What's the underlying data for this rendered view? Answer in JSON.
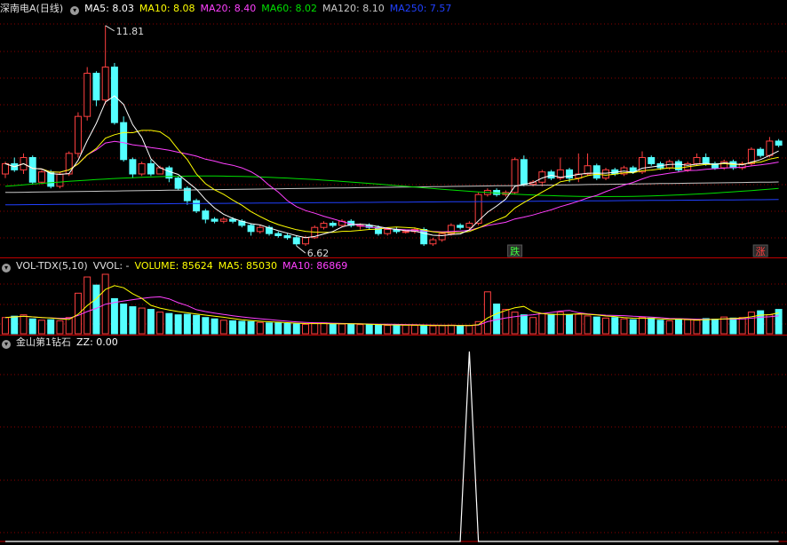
{
  "colors": {
    "up": "#ff4040",
    "down": "#54ffff",
    "ma5": "#ffffff",
    "ma10": "#ffff00",
    "ma20": "#ff40ff",
    "ma60": "#00e000",
    "ma120": "#c8c8c8",
    "ma250": "#2040ff",
    "grid": "#8c0000",
    "border": "#c00000",
    "zz": "#ffffff"
  },
  "main": {
    "title": "深南电A(日线)",
    "icon": "chevron-down-icon",
    "ma": [
      {
        "label": "MA5: 8.03",
        "color": "#ffffff"
      },
      {
        "label": "MA10: 8.08",
        "color": "#ffff00"
      },
      {
        "label": "MA20: 8.40",
        "color": "#ff40ff"
      },
      {
        "label": "MA60: 8.02",
        "color": "#00e000"
      },
      {
        "label": "MA120: 8.10",
        "color": "#c8c8c8"
      },
      {
        "label": "MA250: 7.57",
        "color": "#2040ff"
      }
    ],
    "high_label": "11.81",
    "low_label": "6.62",
    "mark_fall": "跌",
    "mark_rise": "涨"
  },
  "vol": {
    "name": "VOL-TDX(5,10)",
    "vvol": "VVOL: -",
    "volume": "VOLUME: 85624",
    "ma5": "MA5: 85030",
    "ma10": "MA10: 86869",
    "icon": "chevron-down-icon"
  },
  "ind": {
    "name": "金山第1钻石",
    "zz": "ZZ: 0.00",
    "icon": "chevron-down-icon"
  },
  "chart_data": [
    {
      "type": "candlestick",
      "series": [
        {
          "name": "K",
          "ohlc": [
            [
              8.2,
              8.45,
              8.5,
              8.1
            ],
            [
              8.45,
              8.3,
              8.6,
              8.25
            ],
            [
              8.3,
              8.6,
              8.7,
              8.2
            ],
            [
              8.6,
              8.0,
              8.65,
              7.95
            ],
            [
              8.0,
              8.25,
              8.3,
              7.95
            ],
            [
              8.25,
              7.9,
              8.3,
              7.85
            ],
            [
              7.9,
              8.2,
              8.25,
              7.85
            ],
            [
              8.2,
              8.7,
              8.75,
              8.15
            ],
            [
              8.7,
              9.6,
              9.7,
              8.6
            ],
            [
              9.6,
              10.65,
              10.8,
              9.5
            ],
            [
              10.65,
              10.0,
              10.7,
              9.85
            ],
            [
              10.0,
              10.8,
              11.81,
              9.9
            ],
            [
              10.8,
              9.45,
              10.9,
              9.4
            ],
            [
              9.45,
              8.55,
              9.6,
              8.5
            ],
            [
              8.55,
              8.2,
              8.6,
              8.1
            ],
            [
              8.2,
              8.45,
              8.5,
              8.15
            ],
            [
              8.45,
              8.2,
              8.55,
              8.15
            ],
            [
              8.2,
              8.35,
              8.4,
              8.2
            ],
            [
              8.35,
              8.1,
              8.4,
              8.0
            ],
            [
              8.1,
              7.85,
              8.15,
              7.8
            ],
            [
              7.85,
              7.55,
              7.9,
              7.45
            ],
            [
              7.55,
              7.3,
              7.6,
              7.25
            ],
            [
              7.3,
              7.1,
              7.35,
              7.0
            ],
            [
              7.1,
              7.05,
              7.15,
              7.0
            ],
            [
              7.05,
              7.1,
              7.15,
              7.0
            ],
            [
              7.1,
              7.05,
              7.15,
              7.0
            ],
            [
              7.05,
              6.95,
              7.1,
              6.9
            ],
            [
              6.95,
              6.8,
              7.0,
              6.7
            ],
            [
              6.8,
              6.9,
              6.95,
              6.75
            ],
            [
              6.9,
              6.75,
              6.95,
              6.7
            ],
            [
              6.75,
              6.7,
              6.8,
              6.65
            ],
            [
              6.7,
              6.65,
              6.75,
              6.6
            ],
            [
              6.65,
              6.5,
              6.7,
              6.45
            ],
            [
              6.5,
              6.65,
              6.7,
              6.45
            ],
            [
              6.65,
              6.9,
              6.95,
              6.62
            ],
            [
              6.9,
              7.0,
              7.05,
              6.85
            ],
            [
              7.0,
              6.95,
              7.05,
              6.9
            ],
            [
              6.95,
              7.05,
              7.1,
              6.9
            ],
            [
              7.05,
              6.95,
              7.1,
              6.9
            ],
            [
              6.95,
              6.95,
              7.0,
              6.85
            ],
            [
              6.95,
              6.9,
              7.0,
              6.85
            ],
            [
              6.9,
              6.75,
              6.95,
              6.7
            ],
            [
              6.75,
              6.85,
              6.9,
              6.7
            ],
            [
              6.85,
              6.8,
              6.9,
              6.75
            ],
            [
              6.8,
              6.8,
              6.85,
              6.75
            ],
            [
              6.8,
              6.85,
              6.9,
              6.75
            ],
            [
              6.85,
              6.5,
              6.9,
              6.45
            ],
            [
              6.5,
              6.6,
              6.65,
              6.45
            ],
            [
              6.6,
              6.75,
              6.8,
              6.55
            ],
            [
              6.75,
              6.95,
              7.0,
              6.7
            ],
            [
              6.95,
              6.9,
              7.0,
              6.85
            ],
            [
              6.9,
              7.0,
              7.05,
              6.85
            ],
            [
              7.0,
              7.7,
              7.75,
              6.95
            ],
            [
              7.7,
              7.8,
              7.85,
              7.65
            ],
            [
              7.8,
              7.7,
              7.85,
              7.65
            ],
            [
              7.7,
              7.75,
              7.8,
              7.65
            ],
            [
              7.75,
              8.55,
              8.6,
              7.7
            ],
            [
              8.55,
              7.95,
              8.65,
              7.9
            ],
            [
              7.95,
              8.0,
              8.05,
              7.9
            ],
            [
              8.0,
              8.25,
              8.3,
              7.9
            ],
            [
              8.25,
              8.1,
              8.3,
              8.05
            ],
            [
              8.1,
              8.3,
              8.6,
              8.05
            ],
            [
              8.3,
              8.1,
              8.35,
              8.0
            ],
            [
              8.1,
              8.2,
              8.7,
              8.0
            ],
            [
              8.2,
              8.4,
              8.7,
              8.15
            ],
            [
              8.4,
              8.1,
              8.45,
              8.05
            ],
            [
              8.1,
              8.3,
              8.35,
              8.05
            ],
            [
              8.3,
              8.2,
              8.35,
              8.15
            ],
            [
              8.2,
              8.35,
              8.4,
              8.15
            ],
            [
              8.35,
              8.25,
              8.4,
              8.2
            ],
            [
              8.25,
              8.6,
              8.75,
              8.2
            ],
            [
              8.6,
              8.45,
              8.65,
              8.4
            ],
            [
              8.45,
              8.35,
              8.5,
              8.3
            ],
            [
              8.35,
              8.5,
              8.55,
              8.3
            ],
            [
              8.5,
              8.3,
              8.55,
              8.25
            ],
            [
              8.3,
              8.45,
              8.5,
              8.25
            ],
            [
              8.45,
              8.6,
              8.7,
              8.4
            ],
            [
              8.6,
              8.45,
              8.7,
              8.4
            ],
            [
              8.45,
              8.35,
              8.5,
              8.3
            ],
            [
              8.35,
              8.5,
              8.55,
              8.3
            ],
            [
              8.5,
              8.35,
              8.55,
              8.3
            ],
            [
              8.35,
              8.45,
              8.5,
              8.3
            ],
            [
              8.45,
              8.8,
              8.85,
              8.4
            ],
            [
              8.8,
              8.65,
              8.85,
              8.6
            ],
            [
              8.65,
              9.0,
              9.1,
              8.6
            ],
            [
              9.0,
              8.9,
              9.05,
              8.85
            ]
          ]
        }
      ],
      "ylim": [
        6.3,
        12.0
      ],
      "grid": true,
      "annotations": [
        "11.81",
        "6.62",
        "跌",
        "涨"
      ]
    },
    {
      "type": "bar",
      "series": [
        {
          "name": "VOLUME",
          "values": [
            60,
            65,
            70,
            55,
            50,
            52,
            48,
            60,
            150,
            210,
            180,
            220,
            130,
            110,
            100,
            95,
            90,
            80,
            75,
            70,
            72,
            68,
            60,
            55,
            50,
            48,
            46,
            45,
            42,
            40,
            40,
            38,
            36,
            35,
            38,
            40,
            37,
            36,
            35,
            34,
            33,
            32,
            31,
            33,
            32,
            31,
            30,
            29,
            30,
            32,
            31,
            30,
            45,
            155,
            110,
            90,
            80,
            70,
            60,
            75,
            72,
            80,
            70,
            72,
            66,
            62,
            58,
            60,
            55,
            52,
            60,
            58,
            50,
            48,
            55,
            52,
            50,
            56,
            54,
            62,
            58,
            60,
            80,
            85,
            70,
            90
          ]
        }
      ]
    },
    {
      "type": "line",
      "series": [
        {
          "name": "ZZ",
          "values": [
            0,
            0,
            0,
            0,
            0,
            0,
            0,
            0,
            0,
            0,
            0,
            0,
            0,
            0,
            0,
            0,
            0,
            0,
            0,
            0,
            0,
            0,
            0,
            0,
            0,
            0,
            0,
            0,
            0,
            0,
            0,
            0,
            0,
            0,
            0,
            0,
            0,
            0,
            0,
            0,
            0,
            0,
            0,
            0,
            0,
            0,
            0,
            0,
            0,
            0,
            0,
            1,
            0,
            0,
            0,
            0,
            0,
            0,
            0,
            0,
            0,
            0,
            0,
            0,
            0,
            0,
            0,
            0,
            0,
            0,
            0,
            0,
            0,
            0,
            0,
            0,
            0,
            0,
            0,
            0,
            0,
            0,
            0,
            0,
            0,
            0
          ]
        }
      ],
      "ylim": [
        0,
        1
      ]
    }
  ]
}
